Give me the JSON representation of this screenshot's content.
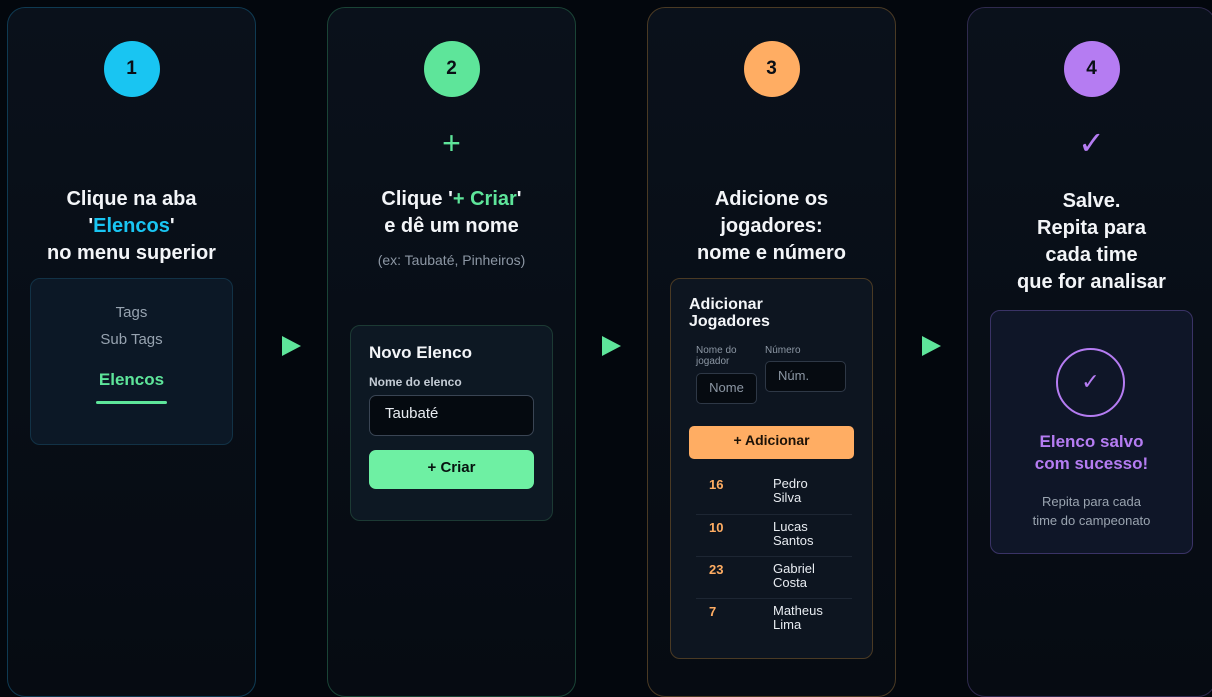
{
  "steps": [
    {
      "number": "1",
      "color": "#19c5f2",
      "heading_line1": "Clique na aba",
      "heading_quote_open": "'",
      "heading_highlight": "Elencos",
      "heading_quote_close": "'",
      "heading_line3": "no menu superior",
      "menu": {
        "items": [
          "Tags",
          "Sub Tags"
        ],
        "active_item": "Elencos"
      }
    },
    {
      "number": "2",
      "color": "#5ee59a",
      "icon": "plus-icon",
      "icon_glyph": "+",
      "heading_pre": "Clique '",
      "heading_highlight": "+ Criar",
      "heading_post": "'",
      "heading_line2": "e dê um nome",
      "hint": "(ex: Taubaté, Pinheiros)",
      "form": {
        "title": "Novo Elenco",
        "field_label": "Nome do elenco",
        "field_value": "Taubaté",
        "button_label": "+ Criar"
      }
    },
    {
      "number": "3",
      "color": "#ffad63",
      "heading_line1": "Adicione os",
      "heading_line2": "jogadores:",
      "heading_line3": "nome e número",
      "panel": {
        "title_line1": "Adicionar",
        "title_line2": "Jogadores",
        "name_label_line1": "Nome do",
        "name_label_line2": "jogador",
        "name_placeholder": "Nome",
        "number_label": "Número",
        "number_placeholder": "Núm.",
        "add_button": "+ Adicionar",
        "players": [
          {
            "number": "16",
            "first": "Pedro",
            "last": "Silva"
          },
          {
            "number": "10",
            "first": "Lucas",
            "last": "Santos"
          },
          {
            "number": "23",
            "first": "Gabriel",
            "last": "Costa"
          },
          {
            "number": "7",
            "first": "Matheus",
            "last": "Lima"
          }
        ]
      }
    },
    {
      "number": "4",
      "color": "#b57cf2",
      "icon": "check-icon",
      "icon_glyph": "✓",
      "heading_line1": "Salve.",
      "heading_line2": "Repita para",
      "heading_line3": "cada time",
      "heading_line4": "que for analisar",
      "success": {
        "check_glyph": "✓",
        "title_line1": "Elenco salvo",
        "title_line2": "com sucesso!",
        "note_line1": "Repita para cada",
        "note_line2": "time do campeonato"
      }
    }
  ],
  "arrows": {
    "glyph": "▶",
    "color": "#5ee59a"
  }
}
